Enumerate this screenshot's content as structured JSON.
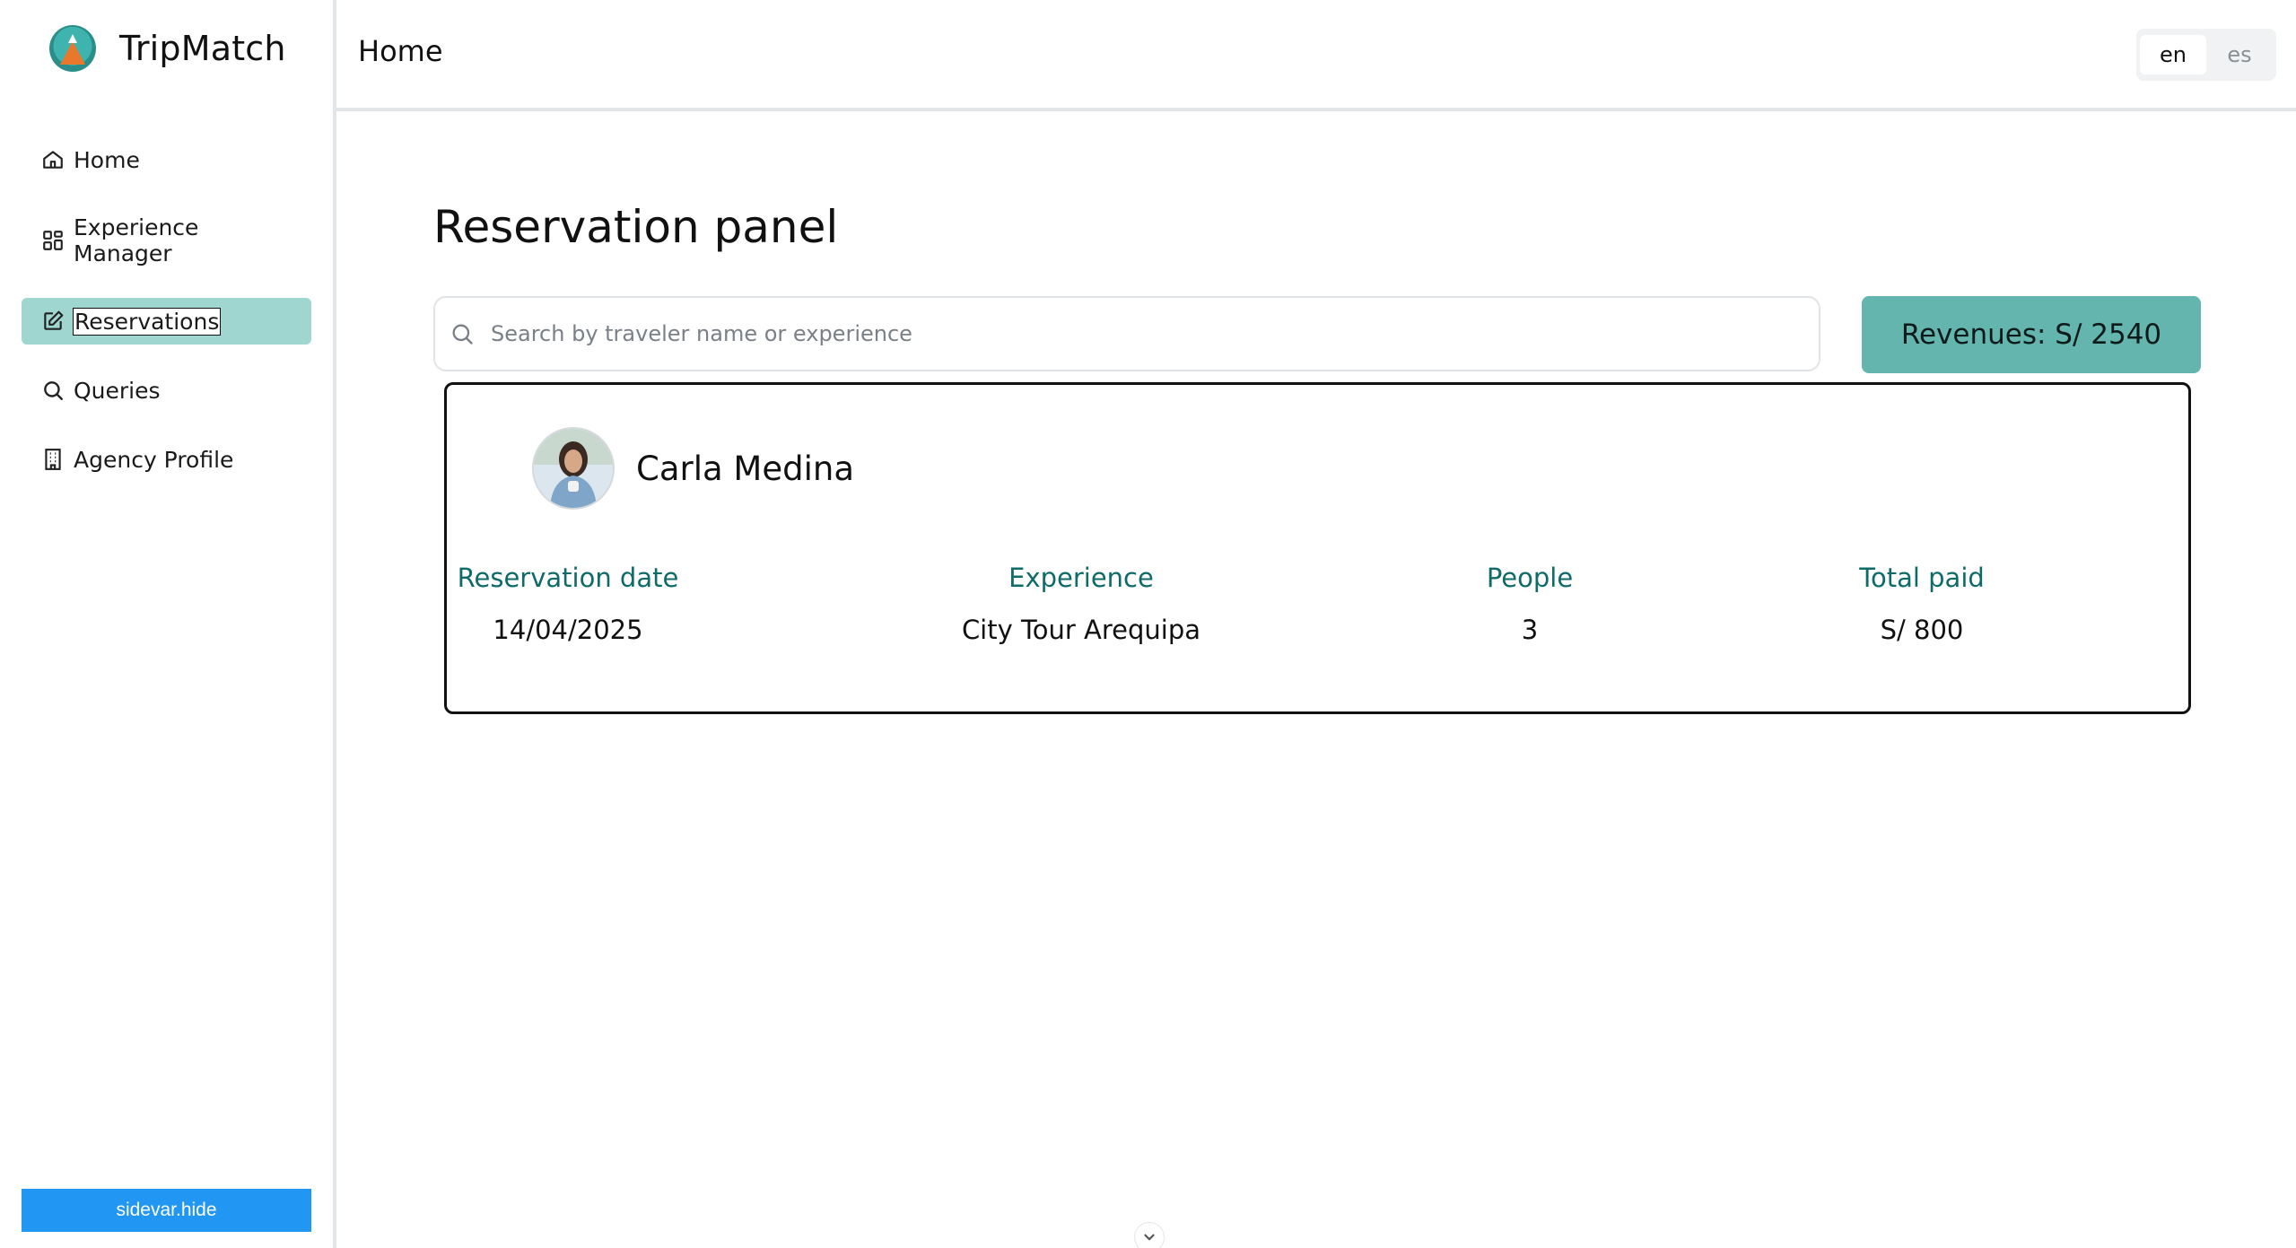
{
  "brand": {
    "name": "TripMatch",
    "logo_icon": "tripmatch-logo-icon"
  },
  "sidebar": {
    "items": [
      {
        "label": "Home",
        "icon": "home-icon",
        "active": false
      },
      {
        "label_line1": "Experience",
        "label_line2": "Manager",
        "icon": "grid-icon",
        "active": false
      },
      {
        "label": "Reservations",
        "icon": "edit-icon",
        "active": true
      },
      {
        "label": "Queries",
        "icon": "search-icon",
        "active": false
      },
      {
        "label": "Agency Profile",
        "icon": "building-icon",
        "active": false
      }
    ],
    "toggle_label": "sidevar.hide"
  },
  "header": {
    "title": "Home",
    "languages": [
      {
        "code": "en",
        "selected": true
      },
      {
        "code": "es",
        "selected": false
      }
    ]
  },
  "main": {
    "title": "Reservation panel",
    "search": {
      "placeholder": "Search by traveler name or experience",
      "value": ""
    },
    "revenue": "Revenues: S/ 2540",
    "reservations": [
      {
        "traveler": "Carla Medina",
        "columns": [
          {
            "header": "Reservation date",
            "value": "14/04/2025"
          },
          {
            "header": "Experience",
            "value": "City Tour Arequipa"
          },
          {
            "header": "People",
            "value": "3"
          },
          {
            "header": "Total paid",
            "value": "S/ 800"
          }
        ]
      }
    ]
  },
  "colors": {
    "active_nav_bg": "#9fd6d0",
    "revenue_bg": "#63b5ae",
    "column_header": "#0f6b68",
    "toggle_button": "#2196f3"
  }
}
